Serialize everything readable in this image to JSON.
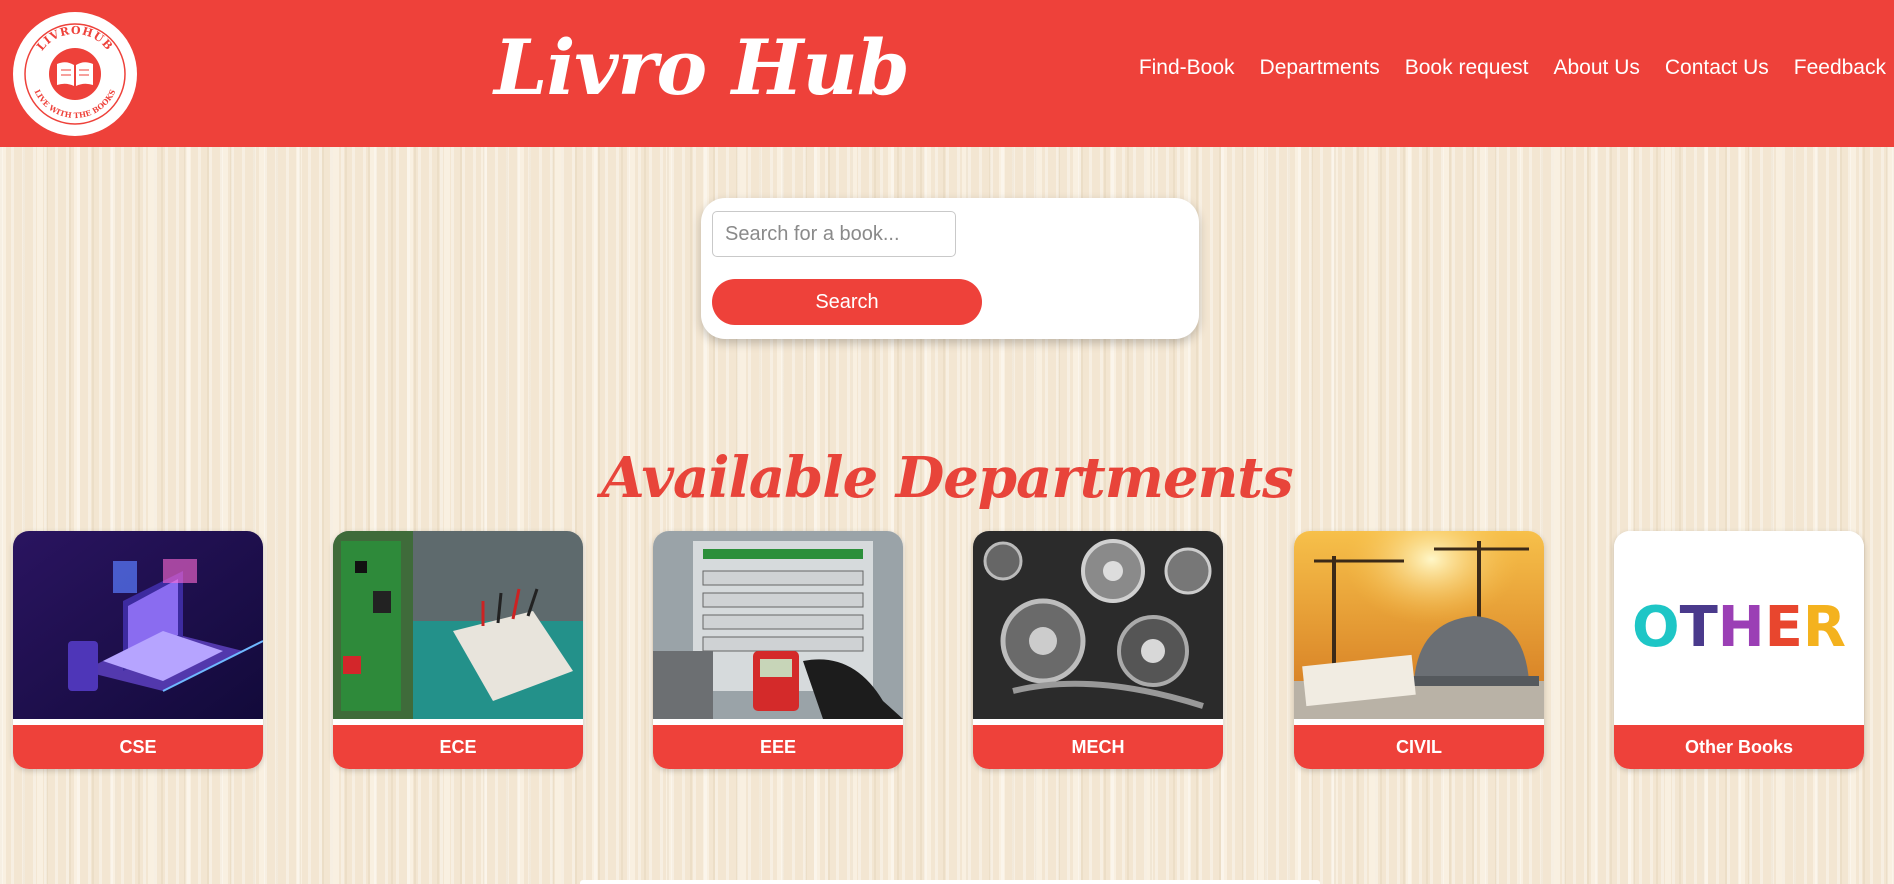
{
  "header": {
    "logo": {
      "top_text": "LIVROHUB",
      "bottom_text": "LIVE WITH THE BOOKS",
      "icon": "open-book-icon"
    },
    "brand": "Livro Hub",
    "nav": [
      "Find-Book",
      "Departments",
      "Book request",
      "About Us",
      "Contact Us",
      "Feedback"
    ]
  },
  "search": {
    "placeholder": "Search for a book...",
    "button": "Search"
  },
  "departments": {
    "title": "Available Departments",
    "items": [
      {
        "label": "CSE",
        "image": "laptop-isometric-illustration"
      },
      {
        "label": "ECE",
        "image": "circuit-board-breadboard"
      },
      {
        "label": "EEE",
        "image": "electrical-panel-multimeter"
      },
      {
        "label": "MECH",
        "image": "engine-gears"
      },
      {
        "label": "CIVIL",
        "image": "construction-cranes-helmet"
      },
      {
        "label": "Other Books",
        "image": "other-wordmark",
        "wordmark": "OTHER"
      }
    ]
  },
  "colors": {
    "primary": "#ee413a",
    "background": "#f3e6d2",
    "other_o": "#1ec6c6",
    "other_t": "#4a3a8c",
    "other_h": "#9b3fb5",
    "other_e": "#e8462e",
    "other_r": "#f4b21e"
  }
}
